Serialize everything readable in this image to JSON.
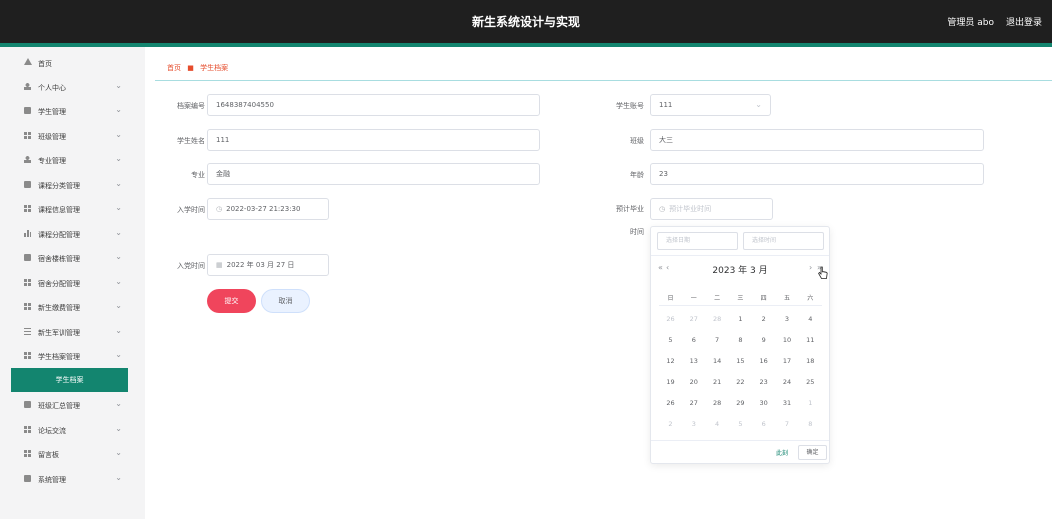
{
  "header": {
    "title": "新生系统设计与实现",
    "admin": "管理员 abo",
    "logout": "退出登录"
  },
  "sidebar": {
    "items": [
      {
        "label": "首页",
        "icon": "home-icon",
        "chevron": false
      },
      {
        "label": "个人中心",
        "icon": "user-icon",
        "chevron": true
      },
      {
        "label": "学生管理",
        "icon": "square-icon",
        "chevron": true
      },
      {
        "label": "班级管理",
        "icon": "grid-icon",
        "chevron": true
      },
      {
        "label": "专业管理",
        "icon": "user-icon",
        "chevron": true
      },
      {
        "label": "课程分类管理",
        "icon": "square-icon",
        "chevron": true
      },
      {
        "label": "课程信息管理",
        "icon": "grid-icon",
        "chevron": true
      },
      {
        "label": "课程分配管理",
        "icon": "bar-chart-icon",
        "chevron": true
      },
      {
        "label": "宿舍楼栋管理",
        "icon": "square-icon",
        "chevron": true
      },
      {
        "label": "宿舍分配管理",
        "icon": "grid-icon",
        "chevron": true
      },
      {
        "label": "新生缴费管理",
        "icon": "grid-icon",
        "chevron": true
      },
      {
        "label": "新生军训管理",
        "icon": "lines-icon",
        "chevron": true
      },
      {
        "label": "学生档案管理",
        "icon": "grid-icon",
        "chevron": true
      },
      {
        "label": "学生档案",
        "sub": true
      },
      {
        "label": "班级汇总管理",
        "icon": "square-icon",
        "chevron": true
      },
      {
        "label": "论坛交流",
        "icon": "grid-icon",
        "chevron": true
      },
      {
        "label": "留言板",
        "icon": "grid-icon",
        "chevron": true
      },
      {
        "label": "系统管理",
        "icon": "square-icon",
        "chevron": true
      }
    ]
  },
  "breadcrumb": {
    "home": "首页",
    "current": "学生档案"
  },
  "form": {
    "archive_no": {
      "label": "档案编号",
      "value": "1648387404550"
    },
    "student_account": {
      "label": "学生账号",
      "value": "111"
    },
    "student_name": {
      "label": "学生姓名",
      "value": "111"
    },
    "class": {
      "label": "班级",
      "value": "大三"
    },
    "major": {
      "label": "专业",
      "value": "金融"
    },
    "age": {
      "label": "年龄",
      "value": "23"
    },
    "enroll_time": {
      "label": "入学时间",
      "value": "2022-03-27 21:23:30"
    },
    "grad_time": {
      "label": "预计毕业时间",
      "label_line1": "预计毕业",
      "label_line2": "时间",
      "placeholder": "预计毕业时间"
    },
    "party_time": {
      "label": "入党时间",
      "value": "2022 年 03 月 27 日"
    },
    "submit": "提交",
    "cancel": "取消"
  },
  "datepicker": {
    "date_placeholder": "选择日期",
    "time_placeholder": "选择时间",
    "year_month": "2023 年  3 月",
    "prev_year": "«",
    "prev_month": "‹",
    "next_month": "›",
    "next_year": "»",
    "weekdays": [
      "日",
      "一",
      "二",
      "三",
      "四",
      "五",
      "六"
    ],
    "weeks": [
      [
        "26",
        "27",
        "28",
        "1",
        "2",
        "3",
        "4"
      ],
      [
        "5",
        "6",
        "7",
        "8",
        "9",
        "10",
        "11"
      ],
      [
        "12",
        "13",
        "14",
        "15",
        "16",
        "17",
        "18"
      ],
      [
        "19",
        "20",
        "21",
        "22",
        "23",
        "24",
        "25"
      ],
      [
        "26",
        "27",
        "28",
        "29",
        "30",
        "31",
        "1"
      ],
      [
        "2",
        "3",
        "4",
        "5",
        "6",
        "7",
        "8"
      ]
    ],
    "muted": [
      [
        true,
        true,
        true,
        false,
        false,
        false,
        false
      ],
      [
        false,
        false,
        false,
        false,
        false,
        false,
        false
      ],
      [
        false,
        false,
        false,
        false,
        false,
        false,
        false
      ],
      [
        false,
        false,
        false,
        false,
        false,
        false,
        false
      ],
      [
        false,
        false,
        false,
        false,
        false,
        false,
        true
      ],
      [
        true,
        true,
        true,
        true,
        true,
        true,
        true
      ]
    ],
    "now_label": "此刻",
    "ok_label": "确定"
  },
  "colors": {
    "accent": "#13856f",
    "danger": "#f0455c",
    "header_bg": "#1f1f1f"
  }
}
